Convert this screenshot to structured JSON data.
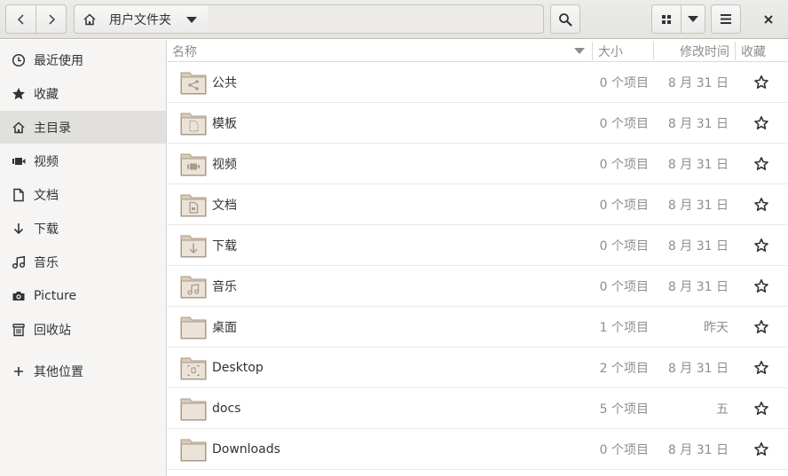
{
  "toolbar": {
    "location": "用户文件夹"
  },
  "sidebar": {
    "items": [
      {
        "label": "最近使用",
        "icon": "clock-icon"
      },
      {
        "label": "收藏",
        "icon": "star-icon"
      },
      {
        "label": "主目录",
        "icon": "home-icon",
        "active": true
      },
      {
        "label": "视频",
        "icon": "video-icon"
      },
      {
        "label": "文档",
        "icon": "document-icon"
      },
      {
        "label": "下载",
        "icon": "download-icon"
      },
      {
        "label": "音乐",
        "icon": "music-icon"
      },
      {
        "label": "Picture",
        "icon": "camera-icon"
      },
      {
        "label": "回收站",
        "icon": "trash-icon"
      },
      {
        "label": "其他位置",
        "icon": "plus-icon"
      }
    ]
  },
  "columns": {
    "name": "名称",
    "size": "大小",
    "modified": "修改时间",
    "starred": "收藏"
  },
  "rows": [
    {
      "name": "公共",
      "size": "0 个项目",
      "modified": "8 月 31 日",
      "emblem": "share-icon"
    },
    {
      "name": "模板",
      "size": "0 个项目",
      "modified": "8 月 31 日",
      "emblem": "template-icon"
    },
    {
      "name": "视频",
      "size": "0 个项目",
      "modified": "8 月 31 日",
      "emblem": "video-icon"
    },
    {
      "name": "文档",
      "size": "0 个项目",
      "modified": "8 月 31 日",
      "emblem": "document-icon"
    },
    {
      "name": "下载",
      "size": "0 个项目",
      "modified": "8 月 31 日",
      "emblem": "download-icon"
    },
    {
      "name": "音乐",
      "size": "0 个项目",
      "modified": "8 月 31 日",
      "emblem": "music-icon"
    },
    {
      "name": "桌面",
      "size": "1 个项目",
      "modified": "昨天",
      "emblem": ""
    },
    {
      "name": "Desktop",
      "size": "2 个项目",
      "modified": "8 月 31 日",
      "emblem": "desktop-icon"
    },
    {
      "name": "docs",
      "size": "5 个项目",
      "modified": "五",
      "emblem": ""
    },
    {
      "name": "Downloads",
      "size": "0 个项目",
      "modified": "8 月 31 日",
      "emblem": ""
    }
  ]
}
